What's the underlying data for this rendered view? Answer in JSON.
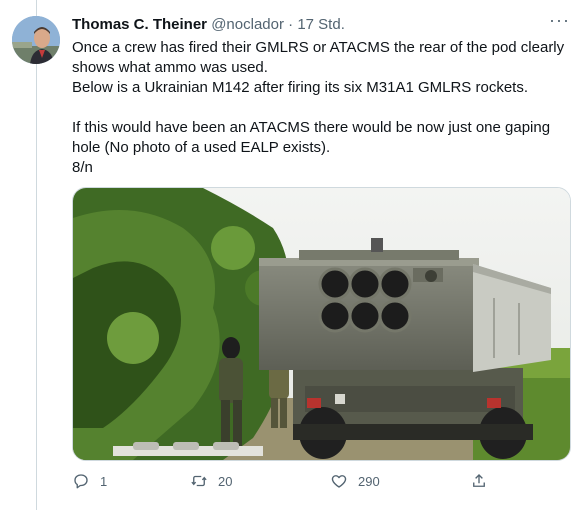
{
  "tweet": {
    "author_name": "Thomas C. Theiner",
    "handle": "@noclador",
    "separator": "·",
    "time": "17 Std.",
    "more_label": "···",
    "lines": [
      "Once a crew has fired their GMLRS or ATACMS the rear of the pod clearly",
      "shows what ammo was used.",
      "Below is a Ukrainian M142 after firing its six M31A1 GMLRS rockets.",
      "",
      "If this would have been an ATACMS there would be now just one gaping",
      "hole (No photo of a used EALP exists).",
      "8/n"
    ]
  },
  "actions": {
    "reply_count": "1",
    "retweet_count": "20",
    "like_count": "290"
  },
  "icons": {
    "reply": "reply-icon",
    "retweet": "retweet-icon",
    "like": "like-icon",
    "share": "share-icon",
    "more": "more-icon"
  },
  "colors": {
    "text_primary": "#0f1419",
    "text_secondary": "#536471",
    "divider": "#cfd9de"
  }
}
